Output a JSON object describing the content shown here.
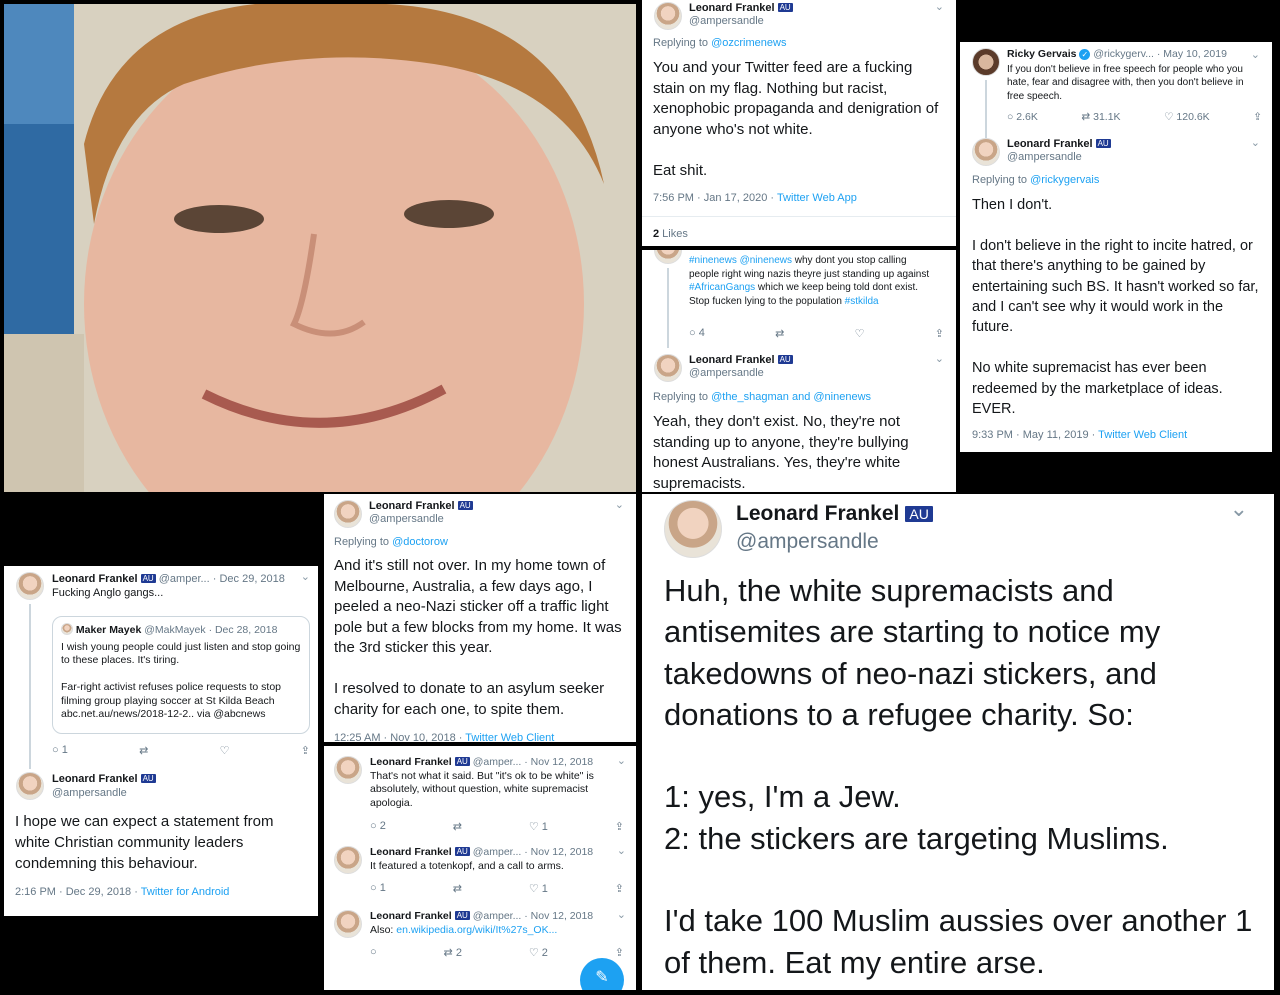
{
  "photo": {
    "description_icon": "portrait-photo"
  },
  "t1": {
    "name": "Leonard Frankel",
    "handle": "@ampersandle",
    "replying_prefix": "Replying to ",
    "replying_to": "@ozcrimenews",
    "body": "You and your Twitter feed are a fucking stain on my flag. Nothing but racist, xenophobic propaganda and denigration of anyone who's not white.\n\nEat shit.",
    "time": "7:56 PM · Jan 17, 2020 · ",
    "client": "Twitter Web App",
    "likes_count": "2",
    "likes_label": " Likes"
  },
  "t2": {
    "quoted_body_1": "#ninenews @ninenews",
    "quoted_body_2": " why dont you stop calling people right wing nazis theyre just standing up against ",
    "quoted_tag": "#AfricanGangs",
    "quoted_body_3": " which we keep being told dont exist. Stop fucken lying to the population ",
    "quoted_tag2": "#stkilda",
    "replies": "4",
    "name": "Leonard Frankel",
    "handle": "@ampersandle",
    "replying_prefix": "Replying to ",
    "replying_to": "@the_shagman and @ninenews",
    "body": "Yeah, they don't exist. No, they're not standing up to anyone, they're bullying honest Australians. Yes, they're white supremacists."
  },
  "t3": {
    "orig_name": "Ricky Gervais",
    "orig_handle": "@rickygerv...",
    "orig_date": "· May 10, 2019",
    "orig_body": "If you don't believe in free speech for people who you hate, fear and disagree with, then you don't believe in free speech.",
    "replies": "2.6K",
    "retweets": "31.1K",
    "likes": "120.6K",
    "name": "Leonard Frankel",
    "handle": "@ampersandle",
    "replying_prefix": "Replying to ",
    "replying_to": "@rickygervais",
    "body": "Then I don't.\n\nI don't believe in the right to incite hatred, or that there's anything to be gained by entertaining such BS. It hasn't worked so far, and I can't see why it would work in the future.\n\nNo white supremacist has ever been redeemed by the marketplace of ideas. EVER.",
    "time": "9:33 PM · May 11, 2019 · ",
    "client": "Twitter Web Client"
  },
  "t4": {
    "name": "Leonard Frankel",
    "handle": "@amper...",
    "date": "· Dec 29, 2018",
    "body": "Fucking Anglo gangs...",
    "quote_name": "Maker Mayek",
    "quote_handle": "@MakMayek",
    "quote_date": "· Dec 28, 2018",
    "quote_body": "I wish young people could just listen and stop going to these places. It's tiring.\n\nFar-right activist refuses police requests to stop filming group playing soccer at St Kilda Beach abc.net.au/news/2018-12-2.. via @abcnews",
    "replies": "1",
    "name2": "Leonard Frankel",
    "handle2": "@ampersandle",
    "body2": "I hope we can expect a statement from white Christian community leaders condemning this behaviour.",
    "time": "2:16 PM · Dec 29, 2018 · ",
    "client": "Twitter for Android"
  },
  "t5": {
    "name": "Leonard Frankel",
    "handle": "@ampersandle",
    "replying_prefix": "Replying to ",
    "replying_to": "@doctorow",
    "body": "And it's still not over. In my home town of Melbourne, Australia, a few days ago, I peeled a neo-Nazi sticker off a traffic light pole but a few blocks from my home. It was the 3rd sticker this year.\n\nI resolved to donate to an asylum seeker charity for each one, to spite them.",
    "time": "12:25 AM · Nov 10, 2018 · ",
    "client": "Twitter Web Client"
  },
  "t6": {
    "items": [
      {
        "name": "Leonard Frankel",
        "handle": "@amper...",
        "date": "· Nov 12, 2018",
        "body": "That's not what it said. But \"it's ok to be white\" is absolutely, without question, white supremacist apologia.",
        "replies": "2",
        "retweets": "",
        "likes": "1"
      },
      {
        "name": "Leonard Frankel",
        "handle": "@amper...",
        "date": "· Nov 12, 2018",
        "body": "It featured a totenkopf, and a call to arms.",
        "replies": "1",
        "retweets": "",
        "likes": "1"
      },
      {
        "name": "Leonard Frankel",
        "handle": "@amper...",
        "date": "· Nov 12, 2018",
        "body": "Also: ",
        "link": "en.wikipedia.org/wiki/It%27s_OK...",
        "replies": "",
        "retweets": "2",
        "likes": "2"
      }
    ]
  },
  "t7": {
    "name": "Leonard Frankel",
    "handle": "@ampersandle",
    "body": "Huh, the white supremacists and antisemites are starting to notice my takedowns of neo-nazi stickers, and donations to a refugee charity. So:\n\n1: yes, I'm a Jew.\n2: the stickers are targeting Muslims.\n\nI'd take 100 Muslim aussies over another 1 of them. Eat my entire arse."
  },
  "colors": {
    "link": "#1da1f2",
    "muted": "#657786",
    "background": "#000000"
  }
}
